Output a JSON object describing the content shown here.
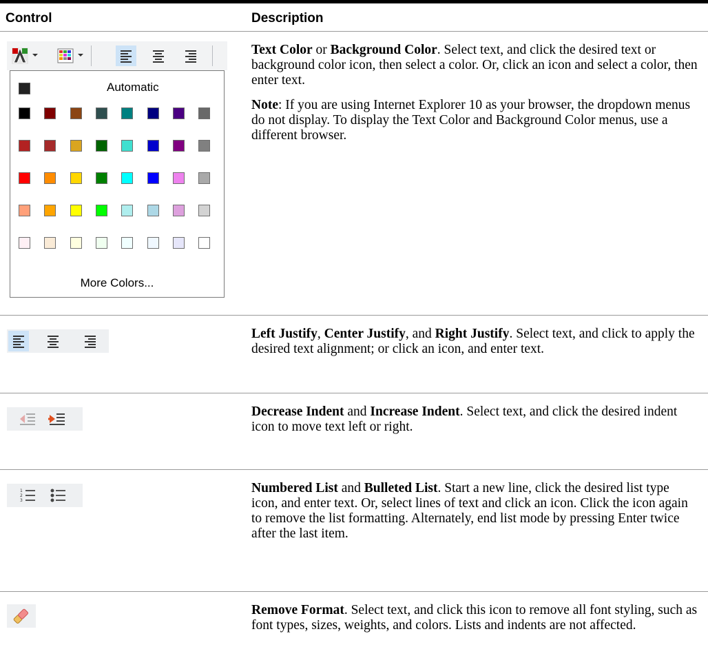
{
  "header": {
    "control": "Control",
    "description": "Description"
  },
  "palette": {
    "automatic_label": "Automatic",
    "more_colors_label": "More Colors...",
    "automatic_color": "#222222",
    "rows": [
      [
        "#000000",
        "#7f0000",
        "#8b4513",
        "#2f4f4f",
        "#008080",
        "#000080",
        "#4b0082",
        "#696969"
      ],
      [
        "#b22222",
        "#a52a2a",
        "#daa520",
        "#006400",
        "#40e0d0",
        "#0000cd",
        "#800080",
        "#808080"
      ],
      [
        "#ff0000",
        "#ff8c00",
        "#ffd700",
        "#008000",
        "#00ffff",
        "#0000ff",
        "#ee82ee",
        "#a9a9a9"
      ],
      [
        "#ffa07a",
        "#ffa500",
        "#ffff00",
        "#00ff00",
        "#afeeee",
        "#add8e6",
        "#dda0dd",
        "#d3d3d3"
      ],
      [
        "#fff0f5",
        "#faebd7",
        "#ffffe0",
        "#f0fff0",
        "#f0ffff",
        "#f0f8ff",
        "#e6e6fa",
        "#ffffff"
      ]
    ]
  },
  "toolbar": {
    "icons": [
      "text-color-icon",
      "background-color-icon",
      "left-justify-icon",
      "center-justify-icon",
      "right-justify-icon"
    ]
  },
  "rows": [
    {
      "icons": [
        "text-color-icon",
        "background-color-icon",
        "left-justify-icon",
        "center-justify-icon",
        "right-justify-icon"
      ],
      "desc1_a": "Text Color",
      "desc1_b": " or ",
      "desc1_c": "Background Color",
      "desc1_d": ". Select text, and click the desired text or background color icon, then select a color. Or, click an icon and select a color, then enter text.",
      "desc2_a": "Note",
      "desc2_b": ": If you are using Internet Explorer 10 as your browser, the dropdown menus do not display.  To display the Text Color and Background Color menus, use a different browser."
    },
    {
      "icons": [
        "left-justify-icon",
        "center-justify-icon",
        "right-justify-icon"
      ],
      "b1": "Left Justify",
      "t1": ", ",
      "b2": "Center Justify",
      "t2": ", and ",
      "b3": "Right Justify",
      "t3": ". Select text, and click to apply the desired text alignment; or click an icon, and enter text."
    },
    {
      "icons": [
        "decrease-indent-icon",
        "increase-indent-icon"
      ],
      "b1": "Decrease Indent",
      "t1": " and ",
      "b2": "Increase Indent",
      "t2": ". Select text, and click the desired indent icon to move text left or right."
    },
    {
      "icons": [
        "numbered-list-icon",
        "bulleted-list-icon"
      ],
      "b1": "Numbered List",
      "t1": " and ",
      "b2": "Bulleted List",
      "t2": ". Start a new line, click the desired list type icon, and enter text. Or, select lines of text and click an icon. Click the icon again to remove the list formatting. Alternately, end list mode by pressing Enter twice after the last item."
    },
    {
      "icons": [
        "eraser-icon"
      ],
      "b1": "Remove Format",
      "t1": ". Select text, and click this icon to remove all font styling, such as font types, sizes, weights, and colors. Lists and indents are not affected."
    }
  ]
}
